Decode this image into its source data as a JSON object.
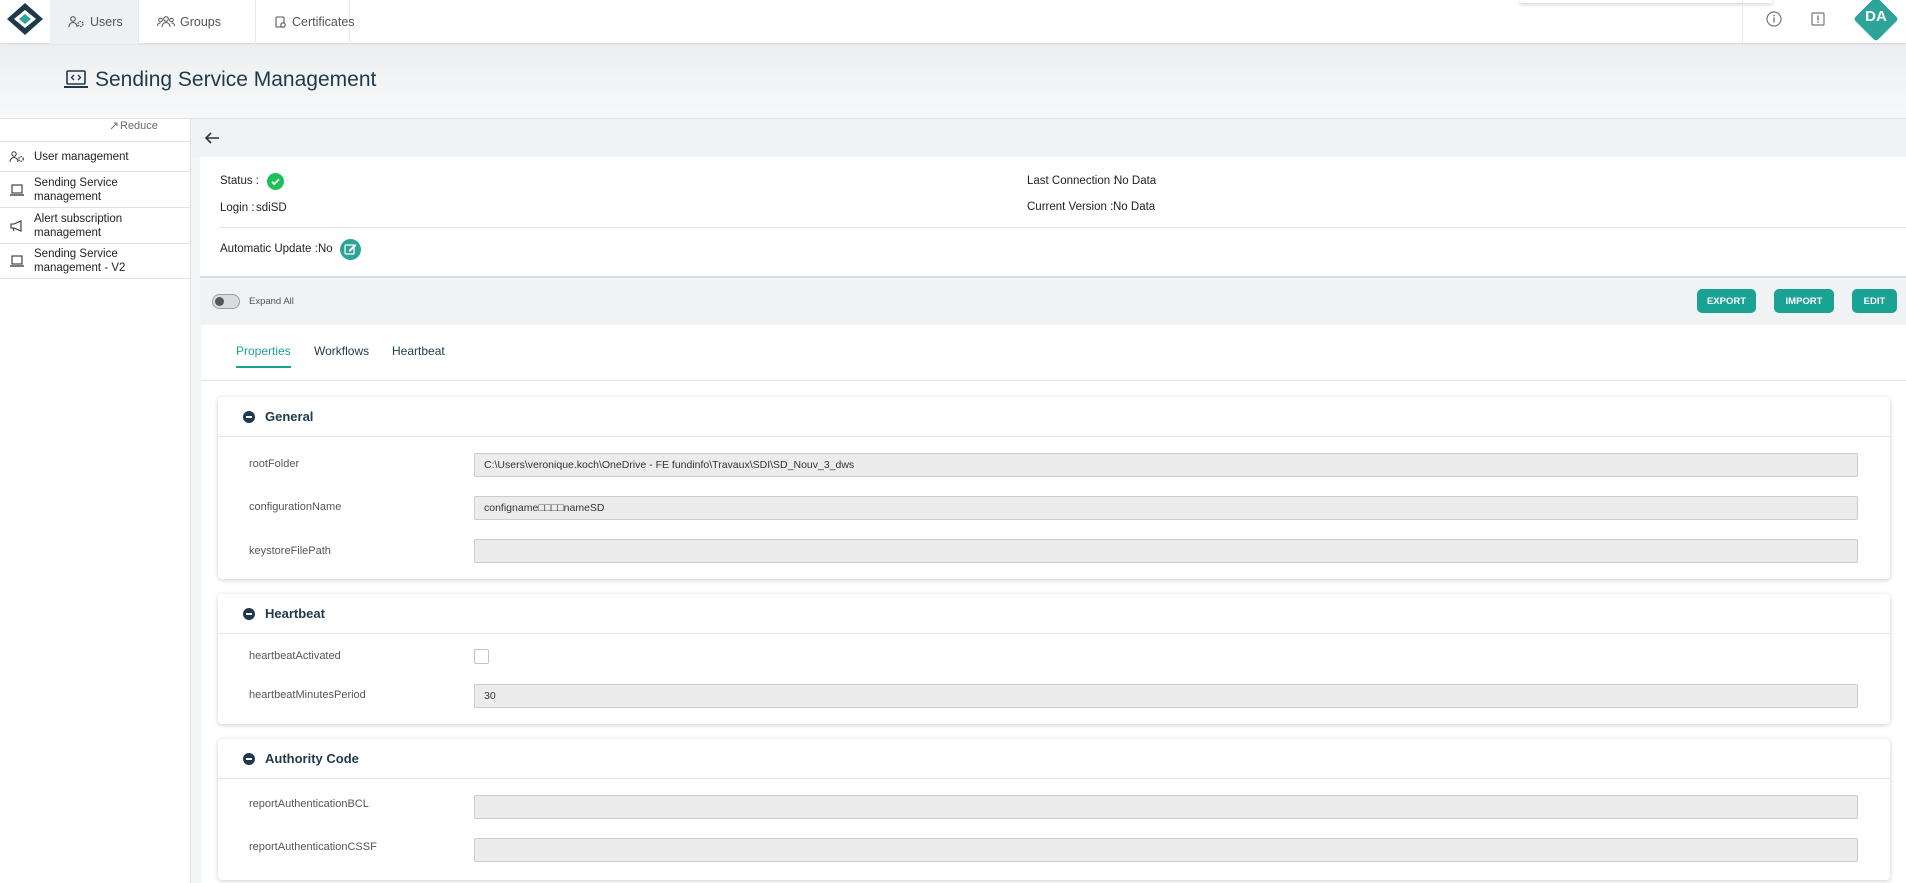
{
  "nav": {
    "tabs": [
      {
        "label": "Users",
        "icon": "users-cog-icon"
      },
      {
        "label": "Groups",
        "icon": "users-group-icon"
      },
      {
        "label": "Certificates",
        "icon": "certificate-icon"
      }
    ],
    "avatar_initials": "DA",
    "colors": {
      "accent": "#1aa295",
      "dark": "#1e3a4a",
      "success": "#1fbf5c"
    }
  },
  "header": {
    "title": "Sending Service Management",
    "icon": "laptop-code-icon"
  },
  "sidebar": {
    "reduce_label": "Reduce",
    "items": [
      {
        "label": "User management",
        "icon": "users-cog-icon"
      },
      {
        "label": "Sending Service management",
        "icon": "laptop-icon"
      },
      {
        "label": "Alert subscription management",
        "icon": "megaphone-icon"
      },
      {
        "label": "Sending Service management - V2",
        "icon": "laptop-icon"
      }
    ]
  },
  "status": {
    "status_label": "Status :",
    "login_label": "Login :",
    "login_value": "sdiSD",
    "last_connection_label": "Last Connection :",
    "last_connection_value": "No Data",
    "current_version_label": "Current Version :",
    "current_version_value": "No Data",
    "auto_update_label": "Automatic Update :",
    "auto_update_value": "No"
  },
  "toolbar": {
    "expand_all_label": "Expand All",
    "export_label": "EXPORT",
    "import_label": "IMPORT",
    "edit_label": "EDIT"
  },
  "tabs": [
    "Properties",
    "Workflows",
    "Heartbeat"
  ],
  "sections": {
    "general": {
      "title": "General",
      "fields": [
        {
          "label": "rootFolder",
          "value": "C:\\Users\\veronique.koch\\OneDrive - FE fundinfo\\Travaux\\SDI\\SD_Nouv_3_dws"
        },
        {
          "label": "configurationName",
          "value": "configname□□□□nameSD"
        },
        {
          "label": "keystoreFilePath",
          "value": ""
        }
      ]
    },
    "heartbeat": {
      "title": "Heartbeat",
      "activated_label": "heartbeatActivated",
      "activated": false,
      "period_label": "heartbeatMinutesPeriod",
      "period_value": "30"
    },
    "authority": {
      "title": "Authority Code",
      "fields": [
        {
          "label": "reportAuthenticationBCL",
          "value": ""
        },
        {
          "label": "reportAuthenticationCSSF",
          "value": ""
        }
      ]
    }
  }
}
